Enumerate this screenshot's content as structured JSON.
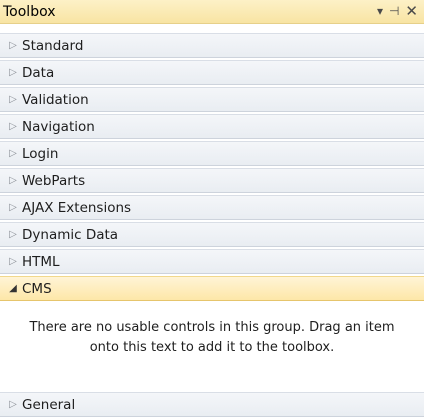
{
  "title": "Toolbox",
  "title_controls": {
    "dropdown": "▾",
    "pin": "⊣",
    "close": "✕"
  },
  "groups": [
    {
      "label": "Standard",
      "arrow": "▷"
    },
    {
      "label": "Data",
      "arrow": "▷"
    },
    {
      "label": "Validation",
      "arrow": "▷"
    },
    {
      "label": "Navigation",
      "arrow": "▷"
    },
    {
      "label": "Login",
      "arrow": "▷"
    },
    {
      "label": "WebParts",
      "arrow": "▷"
    },
    {
      "label": "AJAX Extensions",
      "arrow": "▷"
    },
    {
      "label": "Dynamic Data",
      "arrow": "▷"
    },
    {
      "label": "HTML",
      "arrow": "▷"
    },
    {
      "label": "CMS",
      "arrow": "◢"
    }
  ],
  "empty_message": "There are no usable controls in this group. Drag an item onto this text to add it to the toolbox.",
  "general": {
    "label": "General",
    "arrow": "▷"
  }
}
